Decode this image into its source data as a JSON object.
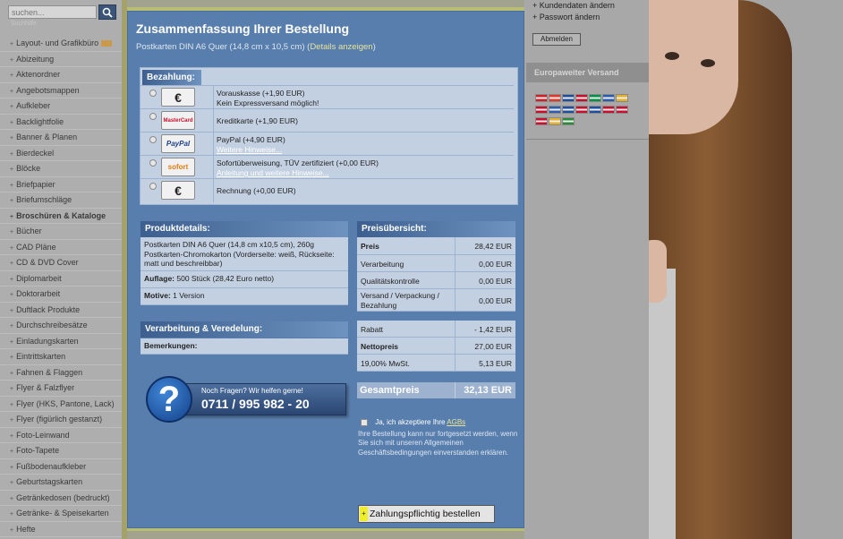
{
  "search": {
    "placeholder": "suchen...",
    "sub_label": "Suchhilfe"
  },
  "nav": [
    {
      "label": "Layout- und Grafikbüro",
      "bold": false,
      "badge": true
    },
    {
      "label": "Abizeitung"
    },
    {
      "label": "Aktenordner"
    },
    {
      "label": "Angebotsmappen"
    },
    {
      "label": "Aufkleber"
    },
    {
      "label": "Backlightfolie"
    },
    {
      "label": "Banner & Planen"
    },
    {
      "label": "Bierdeckel"
    },
    {
      "label": "Blöcke"
    },
    {
      "label": "Briefpapier"
    },
    {
      "label": "Briefumschläge"
    },
    {
      "label": "Broschüren & Kataloge",
      "bold": true
    },
    {
      "label": "Bücher"
    },
    {
      "label": "CAD Pläne"
    },
    {
      "label": "CD & DVD Cover"
    },
    {
      "label": "Diplomarbeit"
    },
    {
      "label": "Doktorarbeit"
    },
    {
      "label": "Duftlack Produkte"
    },
    {
      "label": "Durchschreibesätze"
    },
    {
      "label": "Einladungskarten"
    },
    {
      "label": "Eintrittskarten"
    },
    {
      "label": "Fahnen & Flaggen"
    },
    {
      "label": "Flyer & Falzflyer"
    },
    {
      "label": "Flyer (HKS, Pantone, Lack)"
    },
    {
      "label": "Flyer (figürlich gestanzt)"
    },
    {
      "label": "Foto-Leinwand"
    },
    {
      "label": "Foto-Tapete"
    },
    {
      "label": "Fußbodenaufkleber"
    },
    {
      "label": "Geburtstagskarten"
    },
    {
      "label": "Getränkedosen (bedruckt)"
    },
    {
      "label": "Getränke- & Speisekarten"
    },
    {
      "label": "Hefte"
    }
  ],
  "main": {
    "title": "Zusammenfassung Ihrer Bestellung",
    "subtitle": "Postkarten DIN A6 Quer (14,8 cm x 10,5 cm)",
    "details_link": "Details anzeigen",
    "payment": {
      "heading": "Bezahlung:",
      "options": [
        {
          "icon": "euro-icon",
          "logo_text": "€",
          "text": "Vorauskasse (+1,90 EUR)",
          "sub": "Kein Expressversand möglich!",
          "sub_is_link": false
        },
        {
          "icon": "mastercard-icon",
          "logo_text": "MasterCard",
          "text": "Kreditkarte (+1,90 EUR)",
          "sub": "",
          "sub_is_link": false
        },
        {
          "icon": "paypal-icon",
          "logo_text": "PayPal",
          "text": "PayPal (+4,90 EUR)",
          "sub": "Weitere Hinweise...",
          "sub_is_link": true
        },
        {
          "icon": "sofort-icon",
          "logo_text": "sofort",
          "text": "Sofortüberweisung, TÜV zertifiziert (+0,00 EUR)",
          "sub": "Anleitung und weitere Hinweise...",
          "sub_is_link": true
        },
        {
          "icon": "euro-icon",
          "logo_text": "€",
          "text": "Rechnung (+0,00 EUR)",
          "sub": "",
          "sub_is_link": false
        }
      ]
    },
    "product": {
      "heading": "Produktdetails:",
      "description": "Postkarten DIN A6 Quer (14,8 cm x10,5 cm), 260g Postkarten-Chromokarton (Vorderseite: weiß, Rückseite: matt und beschreibbar)",
      "auflage_label": "Auflage:",
      "auflage_value": "500 Stück (28,42 Euro netto)",
      "motive_label": "Motive:",
      "motive_value": "1 Version"
    },
    "processing": {
      "heading": "Verarbeitung & Veredelung:",
      "remarks_label": "Bemerkungen:"
    },
    "prices": {
      "heading": "Preisübersicht:",
      "rows": [
        {
          "label": "Preis",
          "value": "28,42 EUR",
          "bold": true
        },
        {
          "label": "Verarbeitung",
          "value": "0,00 EUR"
        },
        {
          "label": "Qualitätskontrolle",
          "value": "0,00 EUR"
        },
        {
          "label": "Versand / Verpackung / Bezahlung",
          "value": "0,00 EUR"
        }
      ],
      "rows2": [
        {
          "label": "Rabatt",
          "value": "- 1,42 EUR"
        },
        {
          "label": "Nettopreis",
          "value": "27,00 EUR",
          "bold": true
        },
        {
          "label": "19,00% MwSt.",
          "value": "5,13 EUR"
        }
      ],
      "total_label": "Gesamtpreis",
      "total_value": "32,13 EUR"
    },
    "help": {
      "question": "Noch Fragen? Wir helfen gerne!",
      "phone": "0711 / 995 982 - 20",
      "symbol": "?"
    },
    "agb": {
      "accept_prefix": "Ja, ich akzeptiere Ihre",
      "accept_link": "AGBs",
      "info": "Ihre Bestellung kann nur fortgesetzt werden, wenn Sie sich mit unseren Allgemeinen Geschäftsbedingungen einverstanden erklären."
    },
    "order_button": "Zahlungspflichtig bestellen",
    "order_button_plus": "+"
  },
  "right": {
    "links": [
      "Kundendaten ändern",
      "Passwort ändern"
    ],
    "logout": "Abmelden",
    "eu_heading": "Europaweiter Versand",
    "flags": [
      "#d0202a",
      "#e23a2a",
      "#1d4ea0",
      "#c8102e",
      "#009246",
      "#2a5db0",
      "#e2b02a",
      "#c8102e",
      "#2a5db0",
      "#1d4ea0",
      "#c8102e",
      "#1d4ea0",
      "#c8102e",
      "#c8102e",
      "#c8102e",
      "#e2b02a",
      "#2a8a3a"
    ]
  }
}
